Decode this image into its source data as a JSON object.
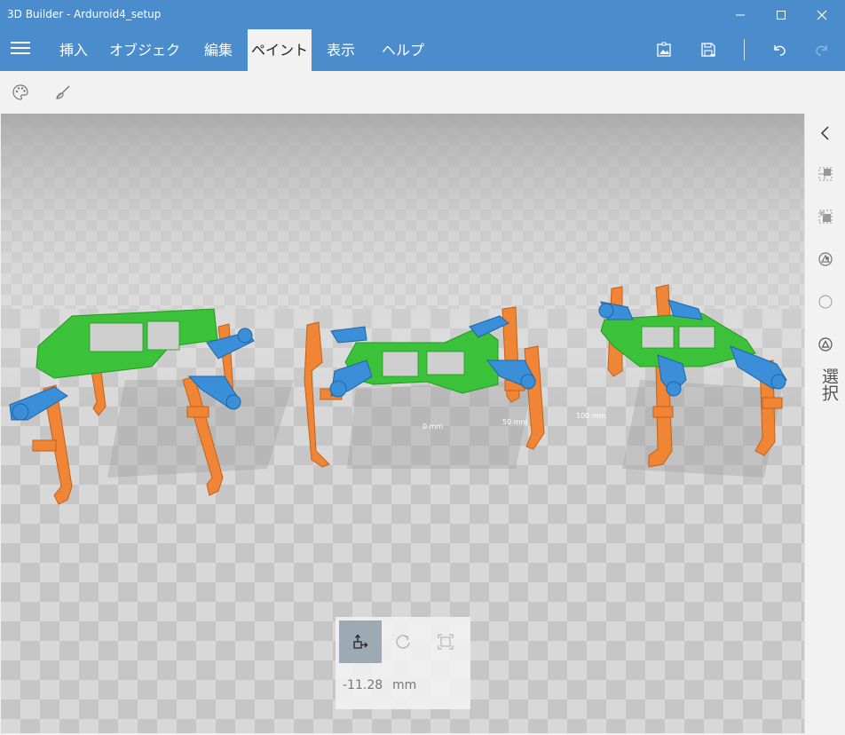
{
  "window": {
    "title": "3D Builder - Arduroid4_setup",
    "controls": [
      "minimize-icon",
      "maximize-icon",
      "close-icon"
    ]
  },
  "menu": {
    "tabs": [
      {
        "label": "挿入",
        "active": false
      },
      {
        "label": "オブジェクト",
        "active": false
      },
      {
        "label": "編集",
        "active": false
      },
      {
        "label": "ペイント",
        "active": true
      },
      {
        "label": "表示",
        "active": false
      },
      {
        "label": "ヘルプ",
        "active": false
      }
    ],
    "right_icons": [
      "image-export-icon",
      "save-icon",
      "undo-icon",
      "redo-icon"
    ]
  },
  "toolbar": {
    "icons": [
      "palette-icon",
      "paint-brush-icon"
    ]
  },
  "right_panel": {
    "label": "選択",
    "icons": [
      "collapse-chevron-icon",
      "select-object-icon",
      "select-faces-icon",
      "select-edges-icon",
      "select-vertices-icon",
      "select-triangles-icon"
    ]
  },
  "transform": {
    "modes": [
      "move-icon",
      "rotate-icon",
      "scale-icon"
    ],
    "active_mode": "move",
    "value": "-11.28",
    "unit": "mm"
  },
  "viewport": {
    "grid_labels": [
      "0 mm",
      "50 mm",
      "100 mm"
    ],
    "colors": {
      "frame": "#3cc13a",
      "legs": "#f08536",
      "servo_horns": "#3a8fd8",
      "floor_light": "#d9d9d9",
      "floor_dark": "#c4c4c4"
    }
  }
}
